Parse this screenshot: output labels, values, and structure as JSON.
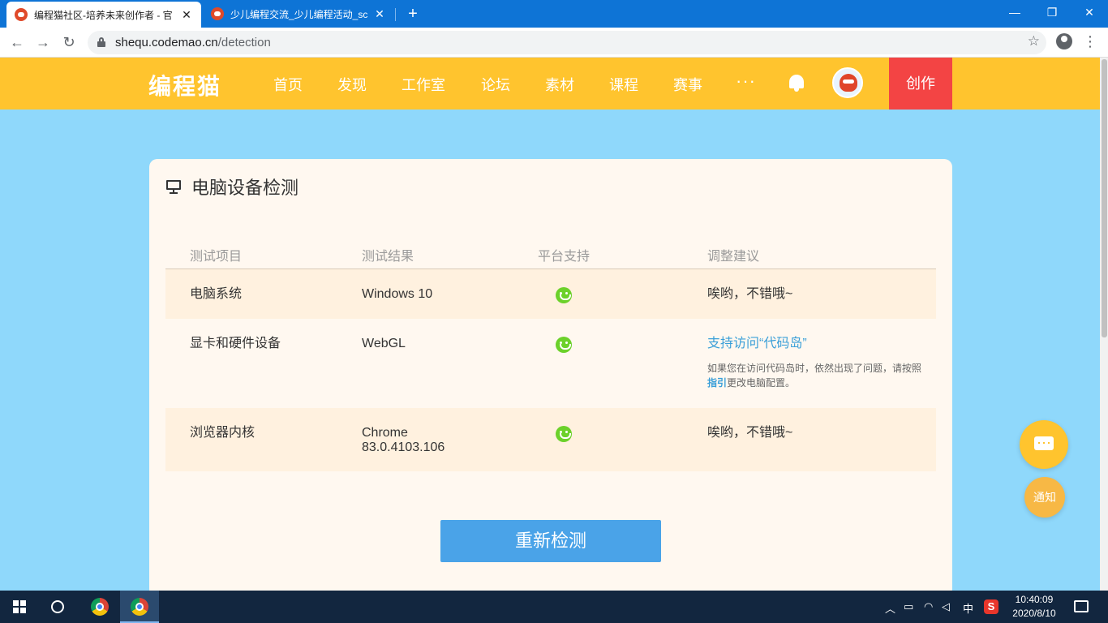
{
  "browser": {
    "tabs": [
      {
        "title": "编程猫社区-培养未来创作者 - 官",
        "active": true
      },
      {
        "title": "少儿编程交流_少儿编程活动_scr",
        "active": false
      }
    ],
    "url_host": "shequ.codemao.cn",
    "url_path": "/detection"
  },
  "site": {
    "logo": "编程猫",
    "nav": [
      "首页",
      "发现",
      "工作室",
      "论坛",
      "素材",
      "课程",
      "赛事"
    ],
    "more": "···",
    "create_label": "创作",
    "accent": "#ffc42e",
    "create_color": "#f34444"
  },
  "card": {
    "title": "电脑设备检测",
    "headers": [
      "测试项目",
      "测试结果",
      "平台支持",
      "调整建议"
    ],
    "rows": [
      {
        "item": "电脑系统",
        "result": "Windows 10",
        "support": "smile-icon",
        "advice": "唉哟，不错哦~"
      },
      {
        "item": "显卡和硬件设备",
        "result": "WebGL",
        "support": "smile-icon",
        "advice": "支持访问“代码岛”",
        "note_pre": "如果您在访问代码岛时，依然出现了问题，请按照",
        "note_link": "指引",
        "note_post": "更改电脑配置。"
      },
      {
        "item": "浏览器内核",
        "result_line1": "Chrome",
        "result_line2": "83.0.4103.106",
        "support": "smile-icon",
        "advice": "唉哟，不错哦~"
      }
    ],
    "recheck_label": "重新检测"
  },
  "float": {
    "notice_label": "通知"
  },
  "taskbar": {
    "ime": "中",
    "sogou": "S",
    "time": "10:40:09",
    "date": "2020/8/10"
  }
}
